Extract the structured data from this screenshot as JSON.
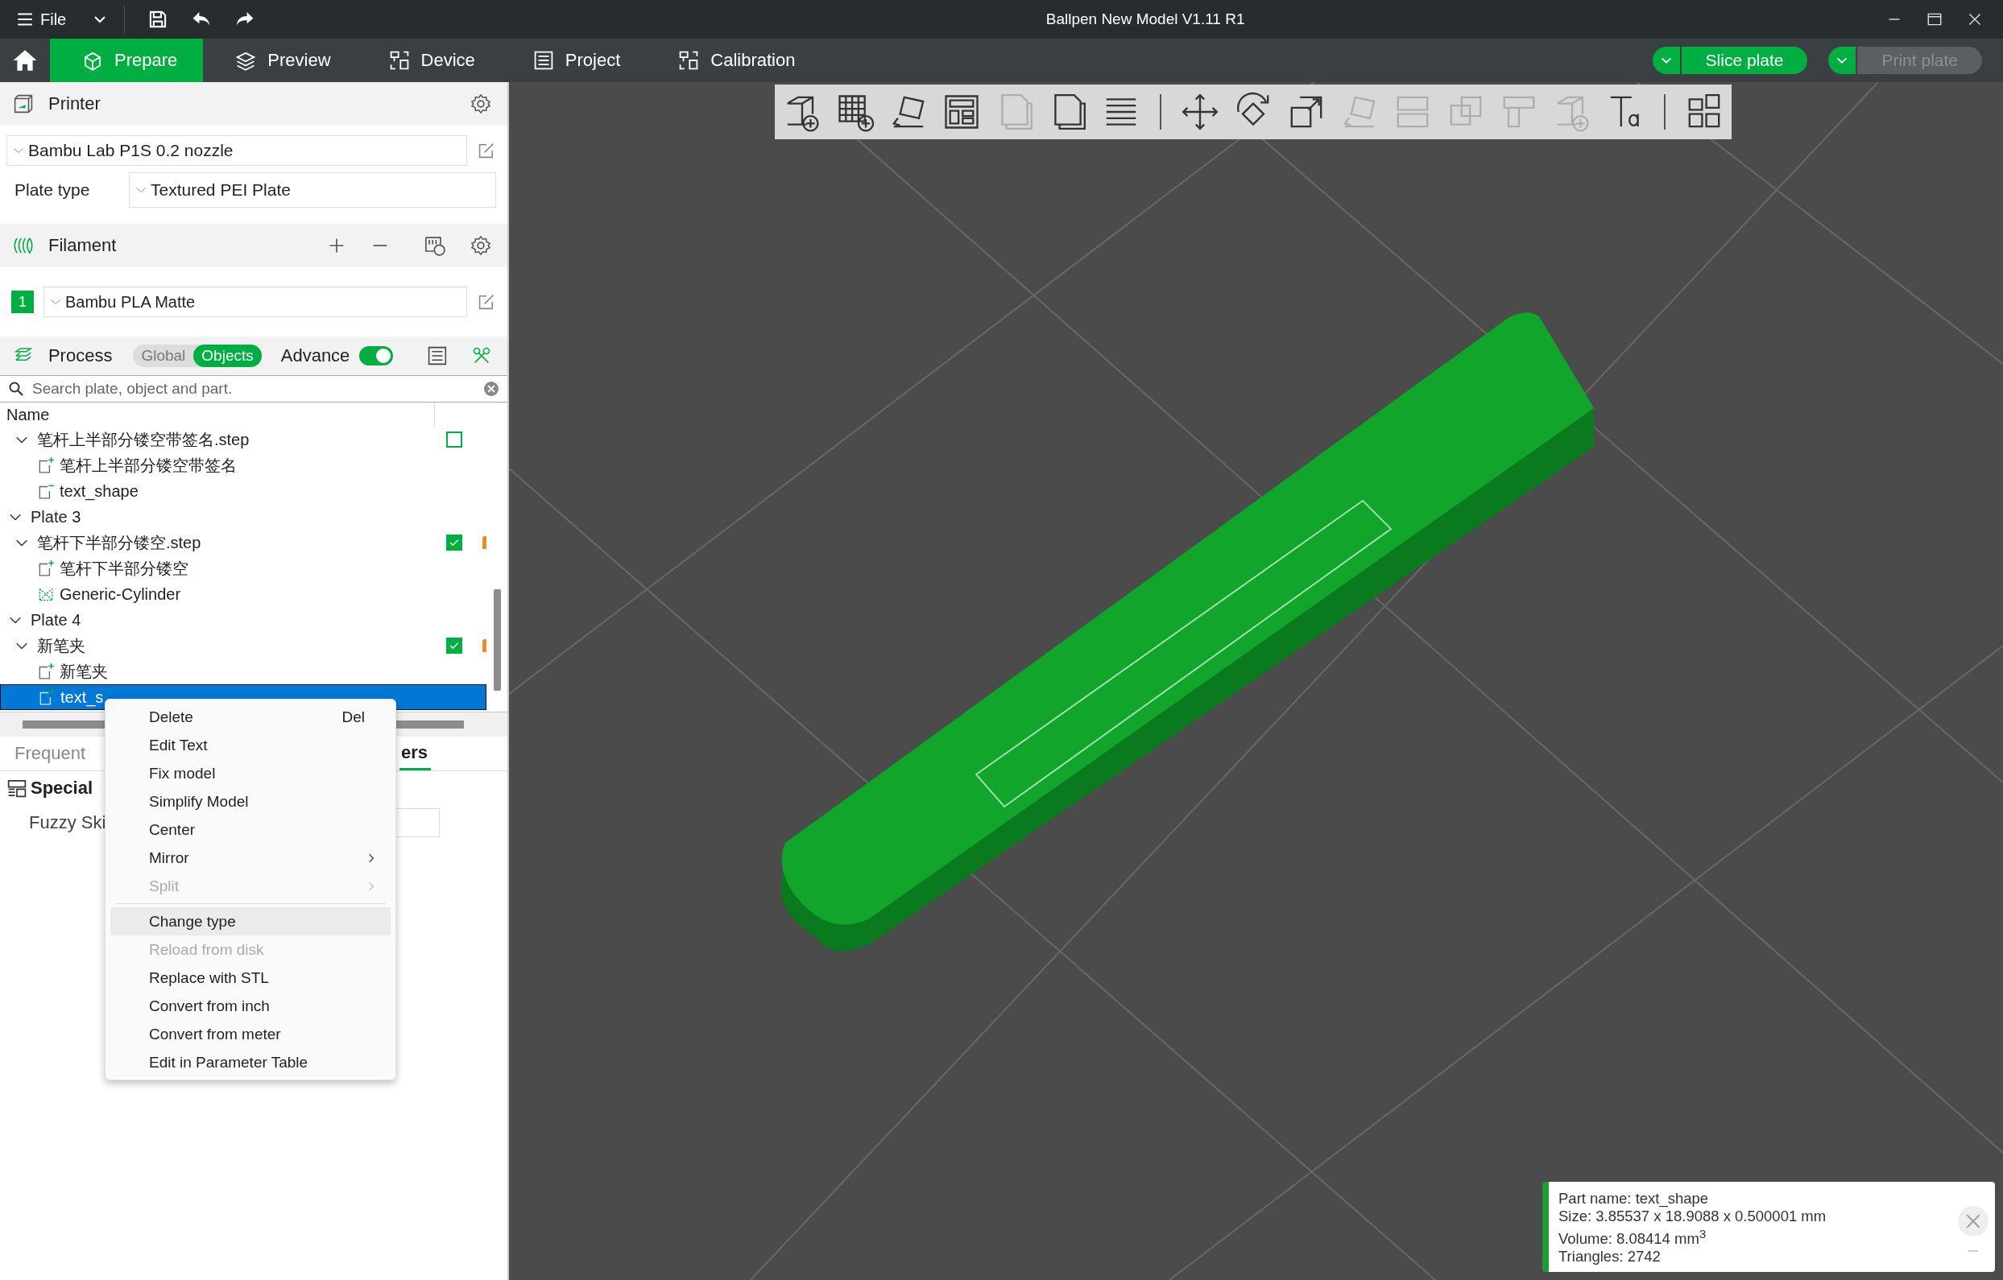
{
  "window": {
    "title": "Ballpen New Model V1.11 R1",
    "menu": "File"
  },
  "nav_tabs": [
    {
      "label": "Prepare",
      "selected": true
    },
    {
      "label": "Preview",
      "selected": false
    },
    {
      "label": "Device",
      "selected": false
    },
    {
      "label": "Project",
      "selected": false
    },
    {
      "label": "Calibration",
      "selected": false
    }
  ],
  "actions": [
    {
      "label": "Slice plate",
      "disabled": false
    },
    {
      "label": "Print plate",
      "disabled": true
    }
  ],
  "printer": {
    "title": "Printer",
    "preset": "Bambu Lab P1S 0.2 nozzle",
    "plate_type_label": "Plate type",
    "plate_type": "Textured PEI Plate"
  },
  "filament": {
    "title": "Filament",
    "slots": [
      {
        "index": "1",
        "color": "#00ae42",
        "name": "Bambu PLA Matte"
      }
    ]
  },
  "process": {
    "title": "Process",
    "scopes": [
      {
        "label": "Global",
        "selected": false
      },
      {
        "label": "Objects",
        "selected": true
      }
    ],
    "advance_label": "Advance",
    "advance_on": true
  },
  "search": {
    "placeholder": "Search plate, object and part."
  },
  "object_list": {
    "column": "Name",
    "tree": [
      {
        "name": "笔杆上半部分镂空带签名.step",
        "kind": "object",
        "expanded": true,
        "checked": false,
        "selected": false,
        "children": [
          {
            "name": "笔杆上半部分镂空带签名",
            "kind": "part",
            "selected": false
          },
          {
            "name": "text_shape",
            "kind": "negative",
            "selected": false
          }
        ]
      },
      {
        "name": "Plate 3",
        "kind": "plate",
        "expanded": true,
        "selected": false,
        "children": [
          {
            "name": "笔杆下半部分镂空.step",
            "kind": "object",
            "expanded": true,
            "checked": true,
            "flag": true,
            "selected": false,
            "children": [
              {
                "name": "笔杆下半部分镂空",
                "kind": "part",
                "selected": false
              },
              {
                "name": "Generic-Cylinder",
                "kind": "modifier",
                "selected": false
              }
            ]
          }
        ]
      },
      {
        "name": "Plate 4",
        "kind": "plate",
        "expanded": true,
        "selected": false,
        "children": [
          {
            "name": "新笔夹",
            "kind": "object",
            "expanded": true,
            "checked": true,
            "flag": true,
            "selected": false,
            "children": [
              {
                "name": "新笔夹",
                "kind": "part",
                "selected": false
              },
              {
                "name": "text_s",
                "kind": "part",
                "selected": true
              }
            ]
          }
        ]
      }
    ]
  },
  "settings_tabs": [
    {
      "label": "Frequent",
      "selected": false
    },
    {
      "label": "ers",
      "selected": true
    }
  ],
  "settings": {
    "group": "Special",
    "rows": [
      {
        "label": "Fuzzy Ski"
      }
    ]
  },
  "context_menu": [
    {
      "label": "Delete",
      "shortcut": "Del",
      "disabled": false,
      "selected": false
    },
    {
      "label": "Edit Text",
      "disabled": false,
      "selected": false
    },
    {
      "label": "Fix model",
      "disabled": false,
      "selected": false
    },
    {
      "label": "Simplify Model",
      "disabled": false,
      "selected": false
    },
    {
      "label": "Center",
      "disabled": false,
      "selected": false
    },
    {
      "label": "Mirror",
      "submenu": true,
      "disabled": false,
      "selected": false
    },
    {
      "label": "Split",
      "submenu": true,
      "disabled": true,
      "selected": false
    },
    {
      "label": "Change type",
      "disabled": false,
      "selected": true,
      "separator_before": true
    },
    {
      "label": "Reload from disk",
      "disabled": true,
      "selected": false
    },
    {
      "label": "Replace with STL",
      "disabled": false,
      "selected": false
    },
    {
      "label": "Convert from inch",
      "disabled": false,
      "selected": false
    },
    {
      "label": "Convert from meter",
      "disabled": false,
      "selected": false
    },
    {
      "label": "Edit in Parameter Table",
      "disabled": false,
      "selected": false
    }
  ],
  "toolbar": [
    {
      "kind": "add",
      "disabled": false
    },
    {
      "kind": "grid_add",
      "disabled": false
    },
    {
      "kind": "auto_orient",
      "disabled": false
    },
    {
      "kind": "arrange",
      "disabled": false
    },
    {
      "kind": "pages",
      "disabled": true
    },
    {
      "kind": "pages",
      "disabled": false
    },
    {
      "kind": "layers",
      "disabled": false
    },
    {
      "kind": "separator"
    },
    {
      "kind": "move",
      "disabled": false
    },
    {
      "kind": "rotate",
      "disabled": false
    },
    {
      "kind": "scale",
      "disabled": false
    },
    {
      "kind": "auto_orient",
      "disabled": true
    },
    {
      "kind": "cut",
      "disabled": true
    },
    {
      "kind": "boolean",
      "disabled": true
    },
    {
      "kind": "support",
      "disabled": true
    },
    {
      "kind": "add",
      "disabled": true
    },
    {
      "kind": "text",
      "disabled": false
    },
    {
      "kind": "separator"
    },
    {
      "kind": "assembly",
      "disabled": false
    }
  ],
  "part_info": {
    "lines": [
      "Part name: text_shape",
      "Size: 3.85537 x 18.9088 x 0.500001 mm",
      "Volume: 8.08414 mm$^{3}$",
      "Triangles: 2742"
    ]
  }
}
